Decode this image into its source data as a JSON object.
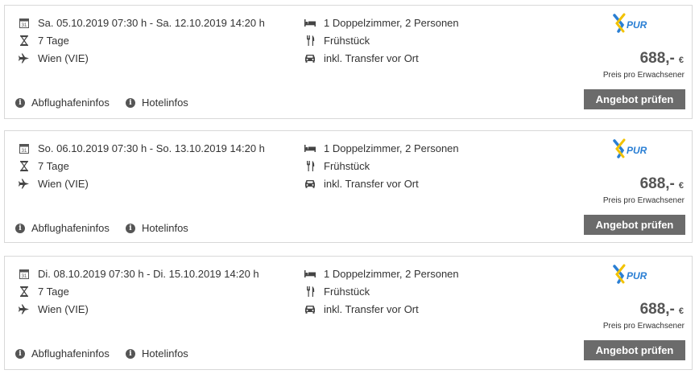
{
  "offers": [
    {
      "dates": "Sa. 05.10.2019 07:30 h - Sa. 12.10.2019 14:20 h",
      "duration": "7 Tage",
      "airport": "Wien (VIE)",
      "room": "1 Doppelzimmer, 2 Personen",
      "board": "Frühstück",
      "transfer": "inkl. Transfer vor Ort",
      "price": "688,-",
      "currency": "€",
      "price_note": "Preis pro Erwachsener",
      "cta": "Angebot prüfen",
      "link_airport": "Abflughafeninfos",
      "link_hotel": "Hotelinfos"
    },
    {
      "dates": "So. 06.10.2019 07:30 h - So. 13.10.2019 14:20 h",
      "duration": "7 Tage",
      "airport": "Wien (VIE)",
      "room": "1 Doppelzimmer, 2 Personen",
      "board": "Frühstück",
      "transfer": "inkl. Transfer vor Ort",
      "price": "688,-",
      "currency": "€",
      "price_note": "Preis pro Erwachsener",
      "cta": "Angebot prüfen",
      "link_airport": "Abflughafeninfos",
      "link_hotel": "Hotelinfos"
    },
    {
      "dates": "Di. 08.10.2019 07:30 h - Di. 15.10.2019 14:20 h",
      "duration": "7 Tage",
      "airport": "Wien (VIE)",
      "room": "1 Doppelzimmer, 2 Personen",
      "board": "Frühstück",
      "transfer": "inkl. Transfer vor Ort",
      "price": "688,-",
      "currency": "€",
      "price_note": "Preis pro Erwachsener",
      "cta": "Angebot prüfen",
      "link_airport": "Abflughafeninfos",
      "link_hotel": "Hotelinfos"
    }
  ],
  "icons": {
    "dates": "calendar-icon",
    "duration": "hourglass-icon",
    "airport": "airplane-icon",
    "room": "bed-icon",
    "board": "cutlery-icon",
    "transfer": "car-icon",
    "info": "info-icon",
    "logo": "xpur-logo"
  },
  "colors": {
    "button_bg": "#6b6b6b",
    "logo_blue": "#2a7fd4",
    "logo_yellow": "#f2c200"
  }
}
